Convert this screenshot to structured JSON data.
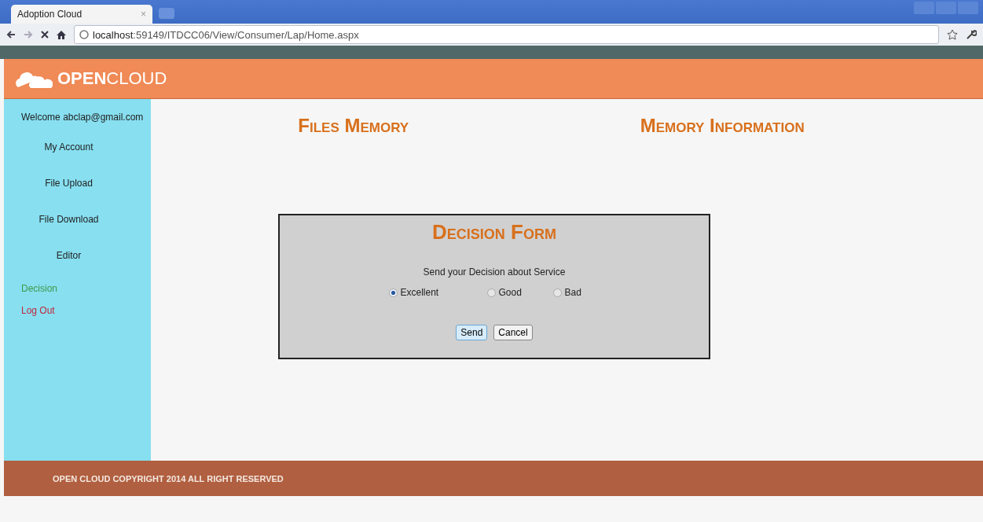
{
  "browser": {
    "tab": {
      "title": "Adoption Cloud",
      "close": "×"
    },
    "address": "**localhost**:59149/ITDCC06/View/Consumer/Lap/Home.aspx"
  },
  "header": {
    "logo": "**OPEN**CLOUD"
  },
  "sidebar": {
    "welcome": "Welcome abclap@gmail.com",
    "items": [
      {
        "label": "My Account",
        "kind": "menu"
      },
      {
        "label": "File Upload",
        "kind": "menu"
      },
      {
        "label": "File Download",
        "kind": "menu"
      },
      {
        "label": "Editor",
        "kind": "menu"
      },
      {
        "label": "Decision",
        "kind": "link",
        "color": "#3f9a4a"
      },
      {
        "label": "Log Out",
        "kind": "link",
        "color": "#c0283c"
      }
    ]
  },
  "headings": [
    "Files Memory",
    "Memory Information"
  ],
  "form": {
    "title": "Decision Form",
    "prompt": "Send your Decision about Service",
    "options": [
      {
        "label": "Excellent",
        "selected": true
      },
      {
        "label": "Good",
        "selected": false
      },
      {
        "label": "Bad",
        "selected": false
      }
    ],
    "buttons": [
      "Send",
      "Cancel"
    ]
  },
  "footer": {
    "text": "OPEN CLOUD COPYRIGHT 2014 ALL RIGHT RESERVED"
  }
}
